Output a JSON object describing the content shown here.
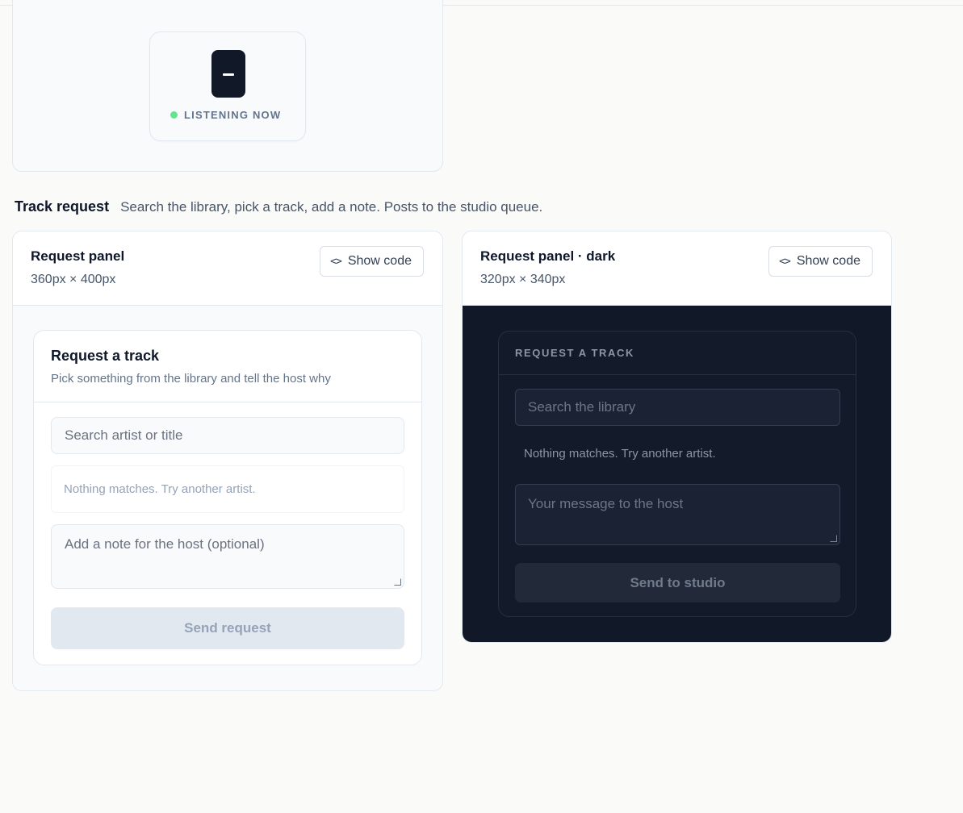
{
  "top_widget": {
    "status_label": "LISTENING NOW",
    "status_color": "#4ade80"
  },
  "section": {
    "title": "Track request",
    "description": "Search the library, pick a track, add a note. Posts to the studio queue."
  },
  "demos": [
    {
      "name": "Request panel",
      "size": "360px × 400px",
      "show_code": "Show code",
      "panel": {
        "title": "Request a track",
        "subtitle": "Pick something from the library and tell the host why",
        "search_placeholder": "Search artist or title",
        "empty_text": "Nothing matches. Try another artist.",
        "note_placeholder": "Add a note for the host (optional)",
        "submit_label": "Send request"
      }
    },
    {
      "name": "Request panel · dark",
      "size": "320px × 340px",
      "show_code": "Show code",
      "panel": {
        "title": "REQUEST A TRACK",
        "search_placeholder": "Search the library",
        "empty_text": "Nothing matches. Try another artist.",
        "note_placeholder": "Your message to the host",
        "submit_label": "Send to studio"
      }
    }
  ],
  "colors": {
    "dark_bg": "#111827",
    "accent_dark_button": "#111827"
  }
}
